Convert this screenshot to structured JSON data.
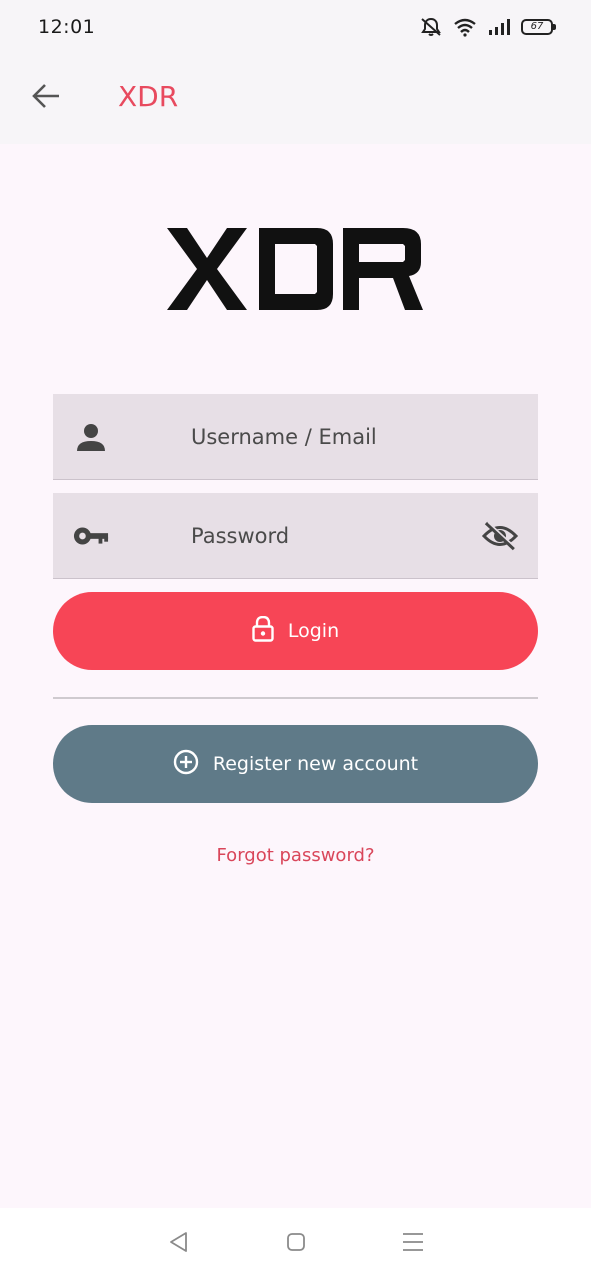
{
  "status_bar": {
    "time": "12:01",
    "battery_level": "67",
    "icons": [
      "mute-icon",
      "wifi-icon",
      "signal-icon",
      "battery-icon"
    ]
  },
  "app_bar": {
    "title": "XDR",
    "back_icon": "arrow-left-icon"
  },
  "logo": {
    "text": "XDR"
  },
  "login_form": {
    "username_placeholder": "Username / Email",
    "username_icon": "person-icon",
    "password_placeholder": "Password",
    "password_icon": "key-icon",
    "visibility_icon": "eye-off-icon",
    "login_label": "Login",
    "login_icon": "lock-icon",
    "register_label": "Register new account",
    "register_icon": "plus-circle-icon",
    "forgot_label": "Forgot password?"
  },
  "nav_bar": {
    "icons": [
      "back-triangle-icon",
      "home-square-icon",
      "menu-icon"
    ]
  },
  "colors": {
    "accent": "#e84a5f",
    "login_button": "#f74556",
    "register_button": "#5f7a88",
    "background": "#fdf6fc",
    "field": "#e7dfe6"
  }
}
